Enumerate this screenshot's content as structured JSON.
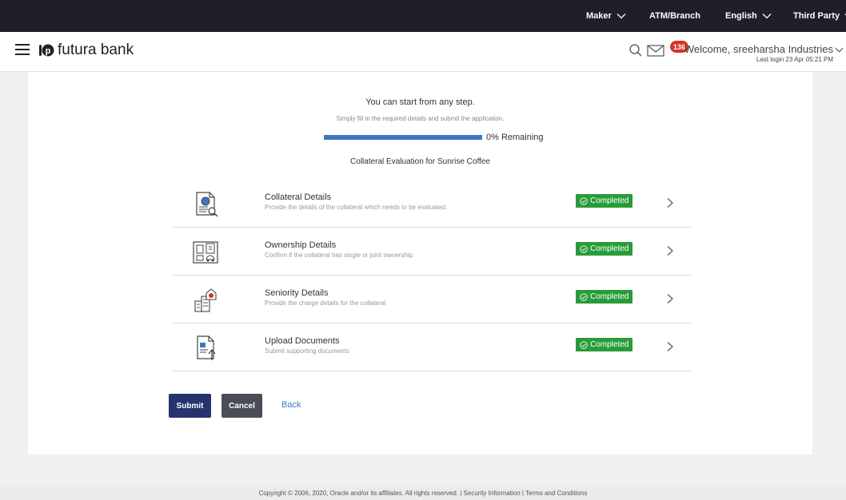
{
  "topbar": {
    "maker_label": "Maker",
    "atm_label": "ATM/Branch",
    "language_label": "English",
    "third_party_label": "Third Party"
  },
  "header": {
    "logo_text": "futura bank",
    "mail_count": "136",
    "welcome_text": "Welcome, sreeharsha Industries",
    "last_login": "Last login 23 Apr 05:21 PM"
  },
  "main": {
    "intro_line1": "You can start from any step.",
    "intro_line2": "Simply fill in the required details and submit the application.",
    "progress_text": "0% Remaining",
    "progress_remaining_percent": 0,
    "application_title": "Collateral Evaluation for Sunrise Coffee",
    "steps": [
      {
        "title": "Collateral Details",
        "description": "Provide the details of the collateral which needs to be evaluated.",
        "status": "Completed",
        "icon": "collateral-document-icon"
      },
      {
        "title": "Ownership Details",
        "description": "Confirm if the collateral has single or joint ownership.",
        "status": "Completed",
        "icon": "ownership-property-icon"
      },
      {
        "title": "Seniority Details",
        "description": "Provide the charge details for the collateral",
        "status": "Completed",
        "icon": "seniority-building-icon"
      },
      {
        "title": "Upload Documents",
        "description": "Submit supporting documents",
        "status": "Completed",
        "icon": "upload-document-icon"
      }
    ],
    "buttons": {
      "submit": "Submit",
      "cancel": "Cancel",
      "back": "Back"
    }
  },
  "footer": {
    "text": "Copyright © 2006, 2020, Oracle and/or its affiliates. All rights reserved. | Security Information | Terms and Conditions"
  },
  "colors": {
    "topbar": "#1f1f2a",
    "primary_button": "#27336f",
    "secondary_button": "#494d55",
    "completed_badge": "#289c3a",
    "progress_bar": "#3c78c2",
    "link": "#3c78c2",
    "notification_badge": "#d33627"
  }
}
